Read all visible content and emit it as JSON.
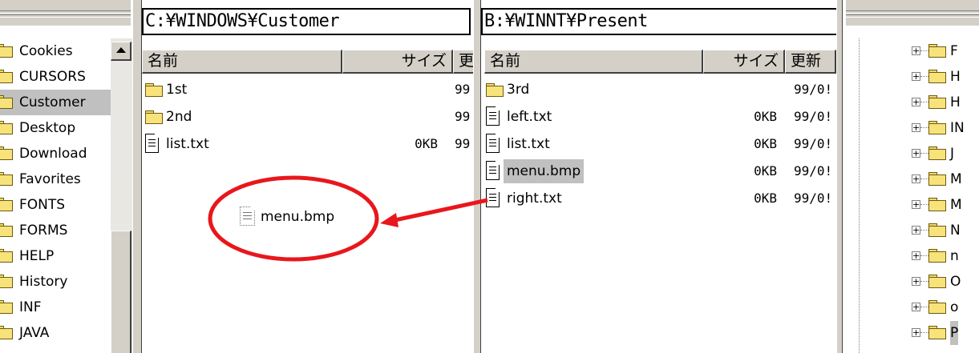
{
  "left_tree": {
    "items": [
      {
        "label": "Cookies",
        "selected": false
      },
      {
        "label": "CURSORS",
        "selected": false
      },
      {
        "label": "Customer",
        "selected": true
      },
      {
        "label": "Desktop",
        "selected": false
      },
      {
        "label": "Download",
        "selected": false
      },
      {
        "label": "Favorites",
        "selected": false
      },
      {
        "label": "FONTS",
        "selected": false
      },
      {
        "label": "FORMS",
        "selected": false
      },
      {
        "label": "HELP",
        "selected": false
      },
      {
        "label": "History",
        "selected": false
      },
      {
        "label": "INF",
        "selected": false
      },
      {
        "label": "JAVA",
        "selected": false
      }
    ]
  },
  "pane1": {
    "path": "C:¥WINDOWS¥Customer",
    "columns": [
      "名前",
      "サイズ",
      "更"
    ],
    "files": [
      {
        "name": "1st",
        "type": "folder",
        "size": "",
        "date": "99"
      },
      {
        "name": "2nd",
        "type": "folder",
        "size": "",
        "date": "99"
      },
      {
        "name": "list.txt",
        "type": "text",
        "size": "0KB",
        "date": "99"
      }
    ],
    "dragged_item": "menu.bmp"
  },
  "pane2": {
    "path": "B:¥WINNT¥Present",
    "columns": [
      "名前",
      "サイズ",
      "更新"
    ],
    "files": [
      {
        "name": "3rd",
        "type": "folder",
        "size": "",
        "date": "99/0!"
      },
      {
        "name": "left.txt",
        "type": "text",
        "size": "0KB",
        "date": "99/0!"
      },
      {
        "name": "list.txt",
        "type": "text",
        "size": "0KB",
        "date": "99/0!"
      },
      {
        "name": "menu.bmp",
        "type": "text",
        "size": "0KB",
        "date": "99/0!",
        "selected": true
      },
      {
        "name": "right.txt",
        "type": "text",
        "size": "0KB",
        "date": "99/0!"
      }
    ]
  },
  "right_tree": {
    "items": [
      "F",
      "H",
      "H",
      "IN",
      "J",
      "M",
      "M",
      "N",
      "n",
      "O",
      "o",
      "P"
    ]
  },
  "colors": {
    "annotation": "#e8171c",
    "chrome": "#d4d0c8",
    "folder": "#f7e37a",
    "selection": "#c0c0c0"
  }
}
